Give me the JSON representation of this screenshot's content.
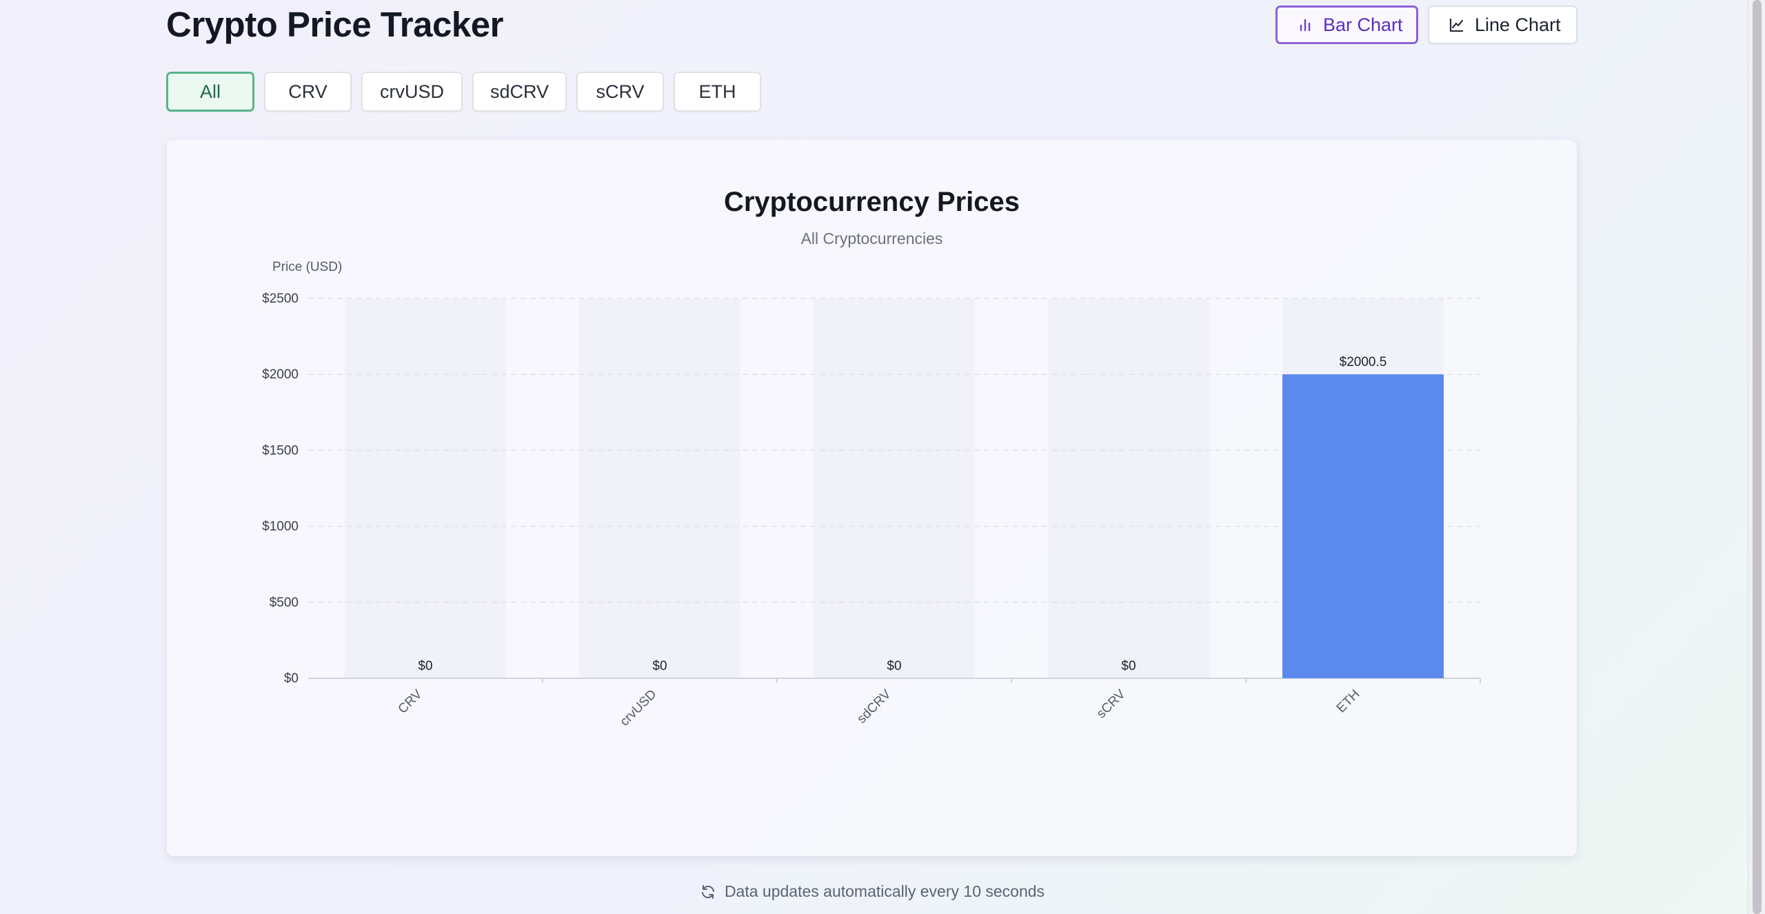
{
  "header": {
    "title": "Crypto Price Tracker",
    "bar_chart_label": "Bar Chart",
    "line_chart_label": "Line Chart"
  },
  "filters": [
    "All",
    "CRV",
    "crvUSD",
    "sdCRV",
    "sCRV",
    "ETH"
  ],
  "active_filter": "All",
  "chart_data": {
    "type": "bar",
    "title": "Cryptocurrency Prices",
    "subtitle": "All Cryptocurrencies",
    "ylabel": "Price (USD)",
    "xlabel": "",
    "categories": [
      "CRV",
      "crvUSD",
      "sdCRV",
      "sCRV",
      "ETH"
    ],
    "values": [
      0,
      0,
      0,
      0,
      2000.5
    ],
    "data_labels": [
      "$0",
      "$0",
      "$0",
      "$0",
      "$2000.5"
    ],
    "yticks": [
      0,
      500,
      1000,
      1500,
      2000,
      2500
    ],
    "ytick_labels": [
      "$0",
      "$500",
      "$1000",
      "$1500",
      "$2000",
      "$2500"
    ],
    "ylim": [
      0,
      2500
    ],
    "grid": true,
    "bar_color": "#5b89ee"
  },
  "footer": {
    "note": "Data updates automatically every 10 seconds"
  }
}
